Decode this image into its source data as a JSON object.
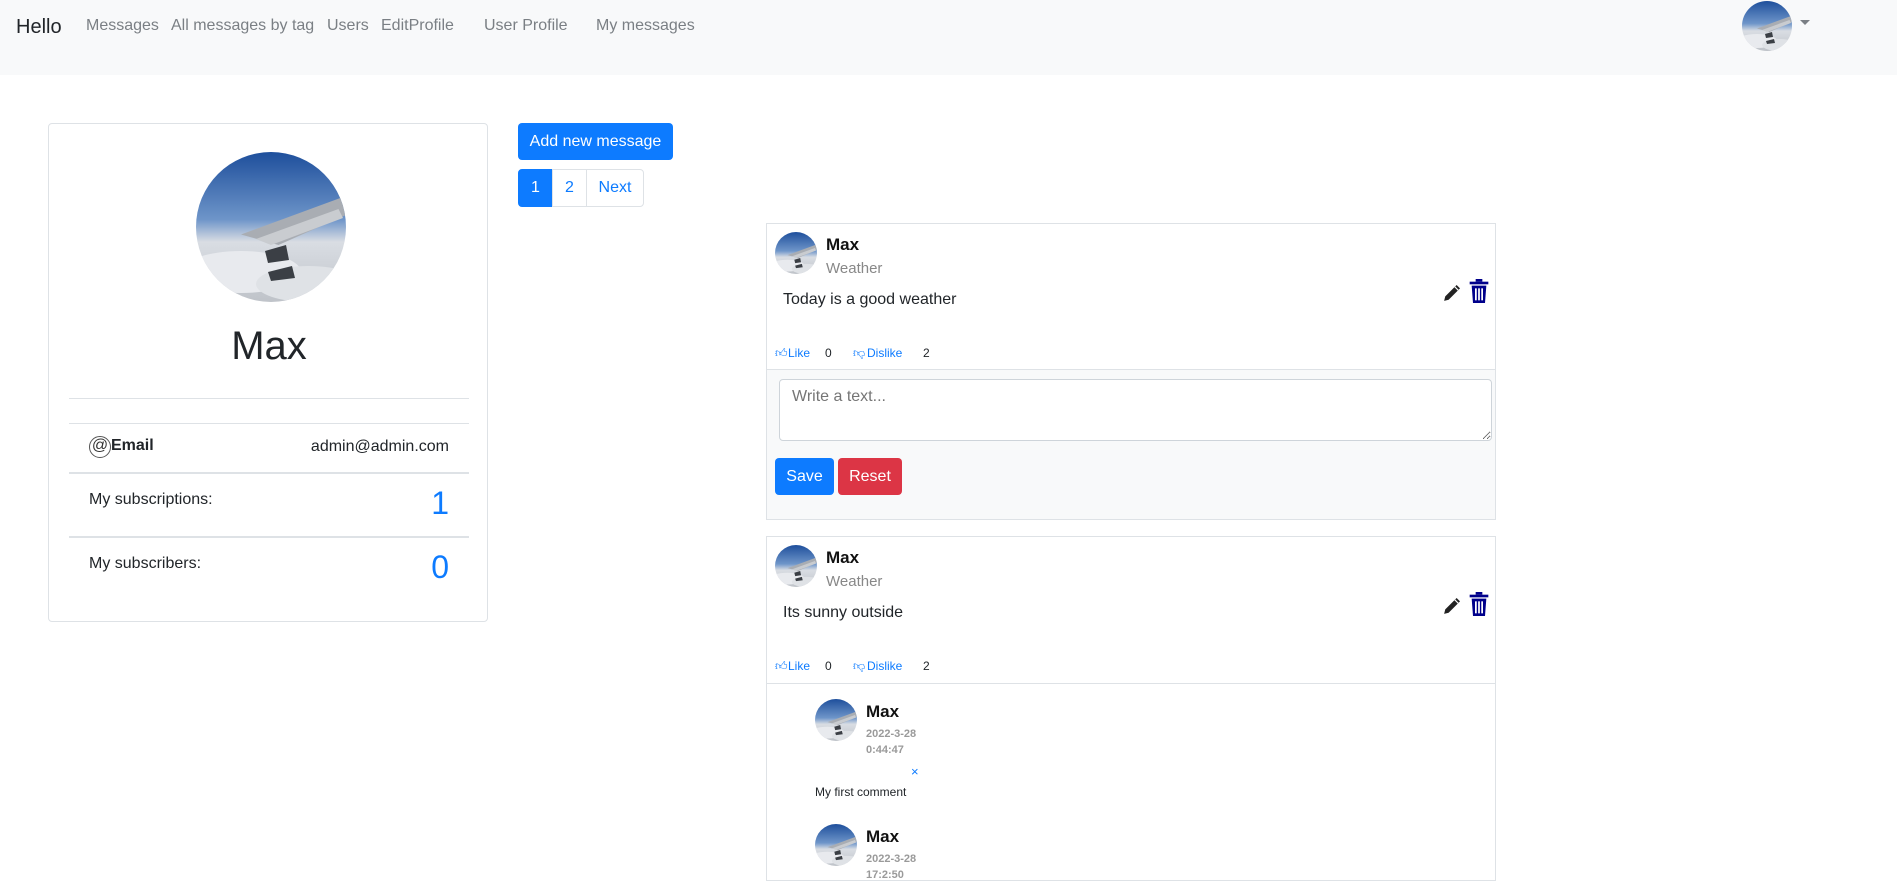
{
  "navbar": {
    "brand": "Hello",
    "links": [
      "Messages",
      "All messages by tag",
      "Users",
      "EditProfile",
      "User Profile",
      "My messages"
    ]
  },
  "profile": {
    "name": "Max",
    "email_label": "Email",
    "email_value": "admin@admin.com",
    "subscriptions_label": "My subscriptions:",
    "subscriptions_count": "1",
    "subscribers_label": "My subscribers:",
    "subscribers_count": "0"
  },
  "actions": {
    "add_message": "Add new message"
  },
  "pagination": {
    "pages": [
      "1",
      "2"
    ],
    "next": "Next",
    "active_page": "1"
  },
  "messages": [
    {
      "author": "Max",
      "tag": "Weather",
      "text": "Today is a good weather",
      "like_label": "Like",
      "like_count": "0",
      "dislike_label": "Dislike",
      "dislike_count": "2",
      "comment_placeholder": "Write a text...",
      "save_label": "Save",
      "reset_label": "Reset"
    },
    {
      "author": "Max",
      "tag": "Weather",
      "text": "Its sunny outside",
      "like_label": "Like",
      "like_count": "0",
      "dislike_label": "Dislike",
      "dislike_count": "2",
      "comments": [
        {
          "author": "Max",
          "date": "2022-3-28",
          "time": "0:44:47",
          "text": "My first comment",
          "close": "×"
        },
        {
          "author": "Max",
          "date": "2022-3-28",
          "time": "17:2:50"
        }
      ]
    }
  ],
  "icons": {
    "edit": "pencil-icon",
    "delete": "trash-icon",
    "like": "thumbs-up-icon",
    "dislike": "thumbs-down-icon",
    "email": "at-icon"
  },
  "colors": {
    "primary": "#0d7bff",
    "danger": "#dc3545",
    "trash": "#00008b",
    "navbar_bg": "#f8f9fa"
  }
}
